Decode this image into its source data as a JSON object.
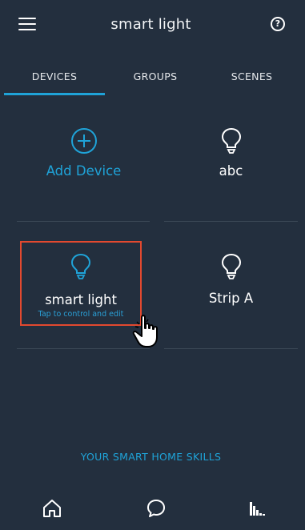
{
  "header": {
    "title": "smart light"
  },
  "tabs": [
    {
      "label": "DEVICES",
      "active": true
    },
    {
      "label": "GROUPS",
      "active": false
    },
    {
      "label": "SCENES",
      "active": false
    }
  ],
  "devices": [
    {
      "label": "Add Device",
      "icon": "plus-circle-icon"
    },
    {
      "label": "abc",
      "icon": "bulb-icon"
    },
    {
      "label": "smart light",
      "sublabel": "Tap to control and edit",
      "icon": "bulb-icon",
      "highlighted": true
    },
    {
      "label": "Strip A",
      "icon": "bulb-icon"
    }
  ],
  "skills_link": "YOUR SMART HOME SKILLS",
  "bottom_nav": [
    {
      "icon": "home-icon"
    },
    {
      "icon": "chat-icon"
    },
    {
      "icon": "activity-icon"
    }
  ],
  "colors": {
    "background": "#232f3e",
    "accent": "#1fa3d8",
    "highlight_border": "#e2492f"
  }
}
